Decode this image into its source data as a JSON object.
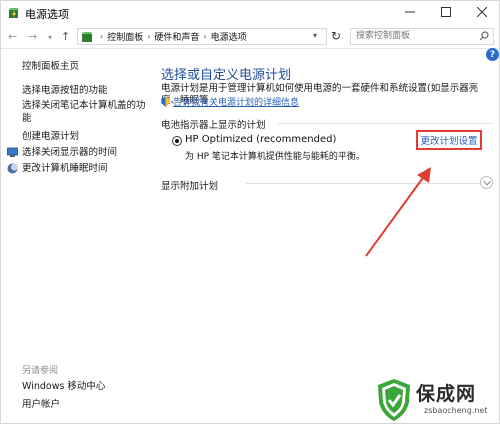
{
  "window": {
    "title": "电源选项",
    "minimize_icon": "minimize-icon",
    "maximize_icon": "maximize-icon",
    "close_icon": "close-icon"
  },
  "address_bar": {
    "breadcrumbs": [
      "控制面板",
      "硬件和声音",
      "电源选项"
    ],
    "search_placeholder": "搜索控制面板"
  },
  "sidebar": {
    "items": [
      {
        "label": "控制面板主页",
        "icon": null
      },
      {
        "label": "选择电源按钮的功能",
        "icon": null
      },
      {
        "label": "选择关闭笔记本计算机盖的功能",
        "icon": null
      },
      {
        "label": "创建电源计划",
        "icon": null
      },
      {
        "label": "选择关闭显示器的时间",
        "icon": "display-shield-icon"
      },
      {
        "label": "更改计算机睡眠时间",
        "icon": "moon-icon"
      }
    ],
    "see_also_title": "另请参阅",
    "see_also": [
      "Windows 移动中心",
      "用户帐户"
    ]
  },
  "main": {
    "title": "选择或自定义电源计划",
    "description": "电源计划是用于管理计算机如何使用电源的一套硬件和系统设置(如显示器亮度、睡眠等",
    "learn_more": "告诉我有关电源计划的详细信息",
    "section_label": "电池指示器上显示的计划",
    "plan": {
      "name": "HP Optimized (recommended)",
      "description": "为 HP 笔记本计算机提供性能与能耗的平衡。",
      "settings_link": "更改计划设置",
      "selected": true
    },
    "extra_plans_label": "显示附加计划"
  },
  "watermark": {
    "title": "保成网",
    "url": "zsbaocheng.net"
  },
  "colors": {
    "link": "#2a5fb8",
    "title": "#1f4e9c",
    "highlight": "#e03c31",
    "watermark_green": "#3aa63a"
  }
}
